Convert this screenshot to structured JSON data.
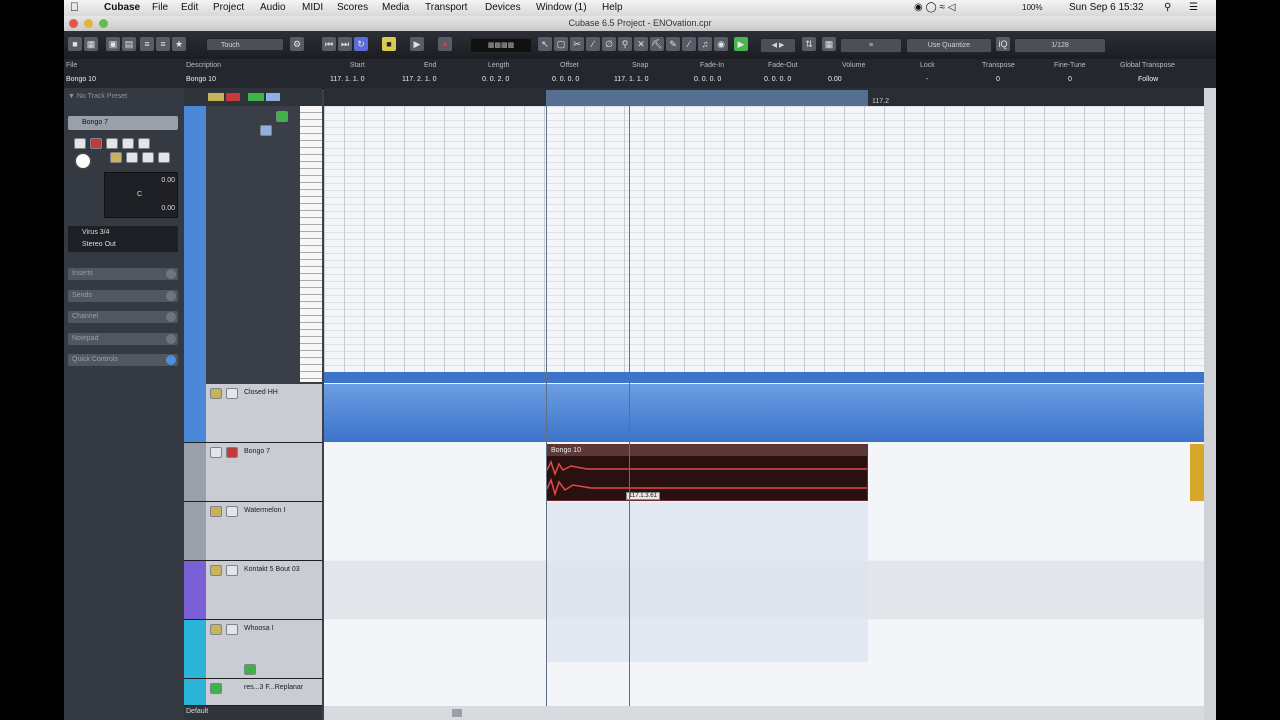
{
  "menubar": {
    "app": "Cubase",
    "items": [
      "File",
      "Edit",
      "Project",
      "Audio",
      "MIDI",
      "Scores",
      "Media",
      "Transport",
      "Devices",
      "Window (1)",
      "Help"
    ],
    "status": {
      "battery": "100%",
      "clock": "Sun Sep 6  15:32"
    }
  },
  "window": {
    "title": "Cubase 6.5 Project - ENOvation.cpr"
  },
  "toolbar": {
    "automation_mode": "Touch",
    "quantize": "Use Quantize",
    "grid": "1/128"
  },
  "infoline": {
    "file_label": "File",
    "file_value": "Bongo 10",
    "desc_label": "Description",
    "desc_value": "Bongo 10",
    "fields": [
      {
        "label": "Start",
        "value": "117.  1.  1.    0"
      },
      {
        "label": "End",
        "value": "117.  2.  1.    0"
      },
      {
        "label": "Length",
        "value": "0.  0.  2.    0"
      },
      {
        "label": "Offset",
        "value": "0.  0.  0.    0"
      },
      {
        "label": "Snap",
        "value": "117.  1.  1.    0"
      },
      {
        "label": "Fade-In",
        "value": "0.  0.  0.    0"
      },
      {
        "label": "Fade-Out",
        "value": "0.  0.  0.    0"
      },
      {
        "label": "Volume",
        "value": "0.00"
      },
      {
        "label": "Lock",
        "value": "-"
      },
      {
        "label": "Transpose",
        "value": "0"
      },
      {
        "label": "Fine-Tune",
        "value": "0"
      },
      {
        "label": "Global Transpose",
        "value": "Follow"
      }
    ]
  },
  "inspector": {
    "preset": "No Track Preset",
    "track": "Bongo 7",
    "vol": "0.00",
    "pan": "C",
    "delay": "0.00",
    "input": "Virus 3/4",
    "output": "Stereo Out",
    "sections": [
      "Inserts",
      "Sends",
      "Channel",
      "Notepad",
      "Quick Controls"
    ]
  },
  "tracks": [
    {
      "name": "Closed HH"
    },
    {
      "name": "Bongo 7"
    },
    {
      "name": "Watermelon I"
    },
    {
      "name": "Kontakt 5 Bout 03"
    },
    {
      "name": "Whoosa I"
    },
    {
      "name": "res...3 F...Replanar"
    }
  ],
  "ruler": {
    "marker": "117.2"
  },
  "event": {
    "name": "Bongo 10",
    "position_tip": "117.1.3.61"
  },
  "footer": {
    "default_label": "Default"
  },
  "colors": {
    "audio_track": "#d1464a",
    "midi_track": "#4b88d8",
    "accent": "#5a86c4"
  }
}
